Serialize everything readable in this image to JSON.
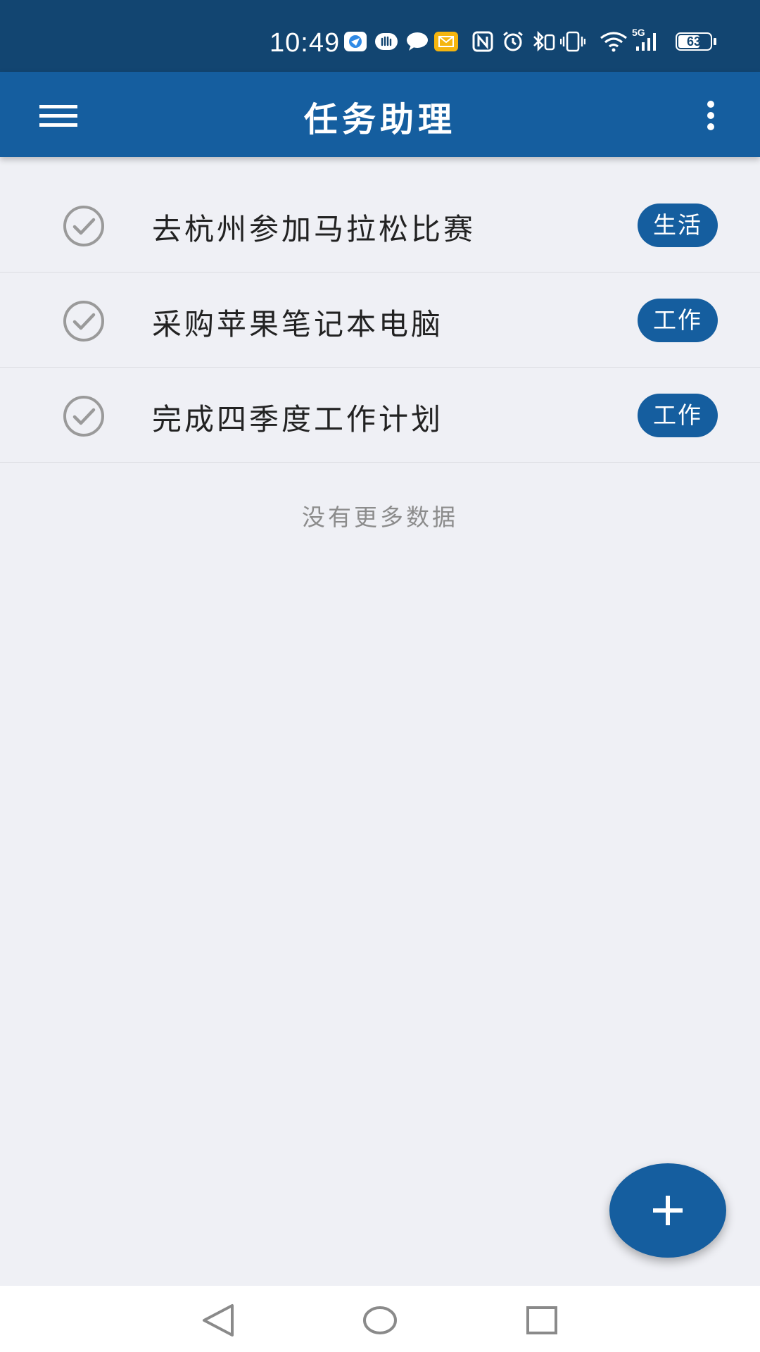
{
  "status_bar": {
    "time": "10:49",
    "icons": [
      "browser-icon",
      "hand-icon",
      "chat-icon",
      "mail-icon",
      "nfc-icon",
      "alarm-icon",
      "bluetooth-icon",
      "vibrate-icon",
      "wifi-icon",
      "signal-5g-icon",
      "battery-icon"
    ],
    "network": "5G",
    "battery": "63"
  },
  "app_bar": {
    "title": "任务助理",
    "menu_icon": "hamburger-menu-icon",
    "more_icon": "more-vertical-icon"
  },
  "tasks": [
    {
      "title": "去杭州参加马拉松比赛",
      "tag": "生活"
    },
    {
      "title": "采购苹果笔记本电脑",
      "tag": "工作"
    },
    {
      "title": "完成四季度工作计划",
      "tag": "工作"
    }
  ],
  "list_footer": "没有更多数据",
  "fab": {
    "icon": "plus-icon"
  },
  "nav_bar": {
    "icons": [
      "back-icon",
      "home-icon",
      "recents-icon"
    ]
  },
  "colors": {
    "status_bar": "#124571",
    "app_bar": "#155e9f",
    "background": "#eff0f5",
    "tag": "#155e9f",
    "check": "#9a9a9a"
  }
}
